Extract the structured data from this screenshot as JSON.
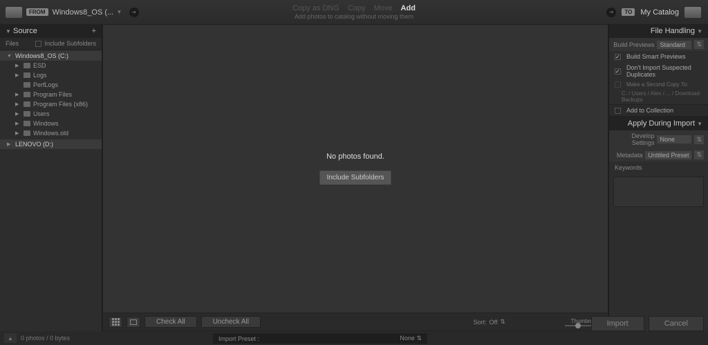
{
  "header": {
    "from_label": "FROM",
    "source_name": "Windows8_OS (...",
    "tabs": {
      "copy_dng": "Copy as DNG",
      "copy": "Copy",
      "move": "Move",
      "add": "Add"
    },
    "sub_text": "Add photos to catalog without moving them",
    "to_label": "TO",
    "dest_name": "My Catalog"
  },
  "source_panel": {
    "title": "Source",
    "tab": "Files",
    "include_subfolders": "Include Subfolders",
    "root": "Windows8_OS (C:)",
    "children": [
      "ESD",
      "Logs",
      "PerfLogs",
      "Program Files",
      "Program Files (x86)",
      "Users",
      "Windows",
      "Windows.old"
    ],
    "drive2": "LENOVO (D:)"
  },
  "center": {
    "message": "No photos found.",
    "include_btn": "Include Subfolders",
    "check_all": "Check All",
    "uncheck_all": "Uncheck All",
    "sort_label": "Sort:",
    "sort_value": "Off",
    "thumbnails_label": "Thumbnails"
  },
  "right": {
    "file_handling": "File Handling",
    "build_previews_label": "Build Previews",
    "build_previews_value": "Standard",
    "smart_previews": "Build Smart Previews",
    "no_dupes": "Don't Import Suspected Duplicates",
    "second_copy": "Make a Second Copy To:",
    "second_copy_path": "C: / Users / Alex / ... / Download Backups",
    "add_collection": "Add to Collection",
    "apply_during": "Apply During Import",
    "develop_label": "Develop Settings",
    "develop_value": "None",
    "metadata_label": "Metadata",
    "metadata_value": "Untitled Preset",
    "keywords_label": "Keywords"
  },
  "actions": {
    "import": "Import",
    "cancel": "Cancel"
  },
  "status": {
    "count": "0 photos / 0 bytes",
    "preset_label": "Import Preset :",
    "preset_value": "None"
  }
}
